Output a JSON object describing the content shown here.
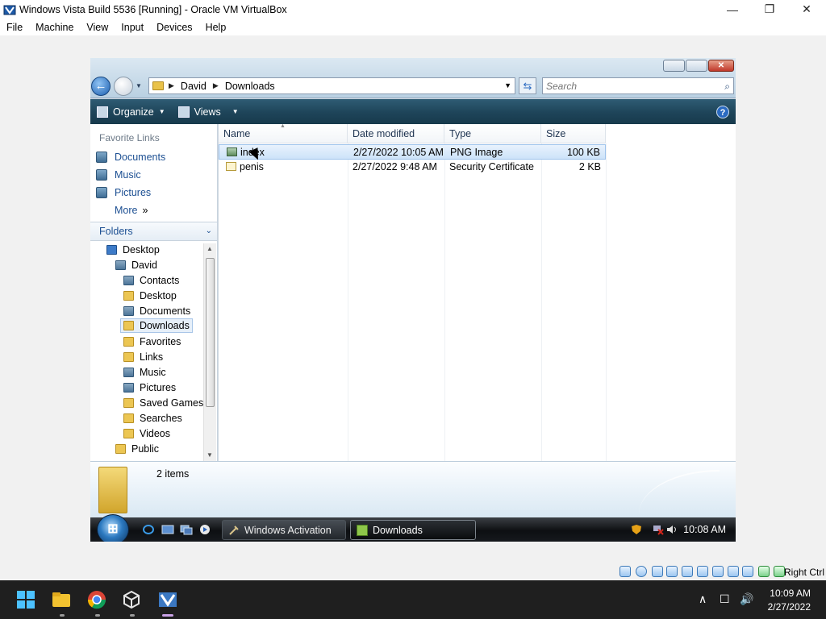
{
  "vbox": {
    "title": "Windows Vista Build 5536 [Running] - Oracle VM VirtualBox",
    "menu": [
      "File",
      "Machine",
      "View",
      "Input",
      "Devices",
      "Help"
    ],
    "host_key": "Right Ctrl"
  },
  "explorer": {
    "breadcrumb": [
      "David",
      "Downloads"
    ],
    "search_placeholder": "Search",
    "commands": {
      "organize": "Organize",
      "views": "Views"
    },
    "favorite_links_heading": "Favorite Links",
    "favorite_links": [
      "Documents",
      "Music",
      "Pictures",
      "More"
    ],
    "folders_heading": "Folders",
    "tree": [
      "Desktop",
      "David",
      "Contacts",
      "Desktop",
      "Documents",
      "Downloads",
      "Favorites",
      "Links",
      "Music",
      "Pictures",
      "Saved Games",
      "Searches",
      "Videos",
      "Public"
    ],
    "columns": [
      "Name",
      "Date modified",
      "Type",
      "Size"
    ],
    "files": [
      {
        "name": "index",
        "date": "2/27/2022 10:05 AM",
        "type": "PNG Image",
        "size": "100 KB"
      },
      {
        "name": "penis",
        "date": "2/27/2022 9:48 AM",
        "type": "Security Certificate",
        "size": "2 KB"
      }
    ],
    "item_count": "2 items"
  },
  "guest_taskbar": {
    "buttons": [
      "Windows Activation",
      "Downloads"
    ],
    "clock": "10:08 AM"
  },
  "host_taskbar": {
    "time": "10:09 AM",
    "date": "2/27/2022"
  },
  "colors": {
    "accent": "#1c4f92",
    "command_bar": "#1e4459",
    "selection": "#cde3f9"
  }
}
